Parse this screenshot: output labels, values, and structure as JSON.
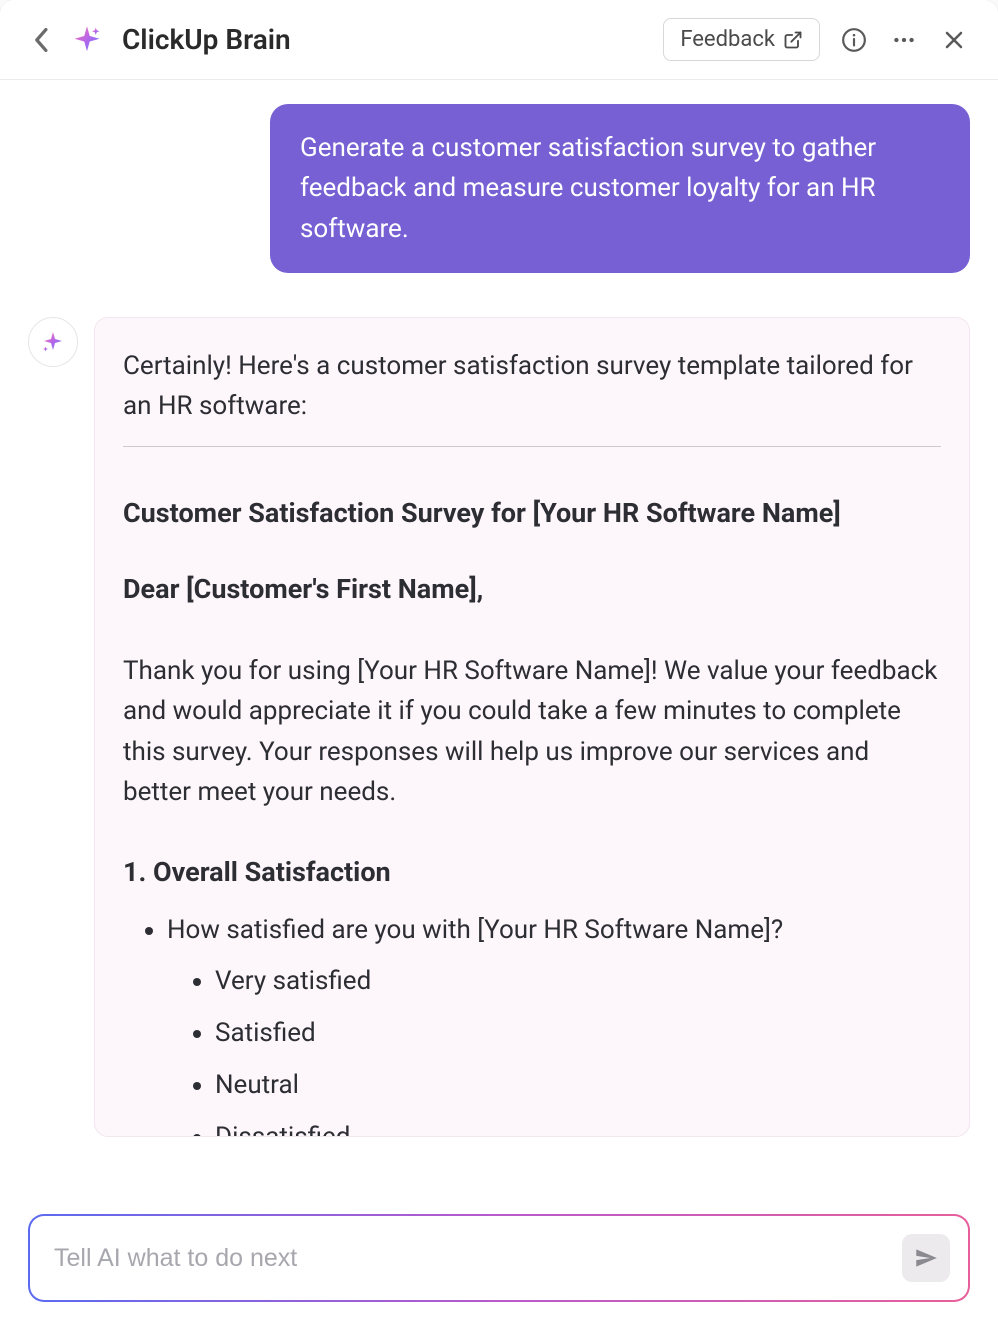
{
  "header": {
    "title": "ClickUp Brain",
    "feedback_label": "Feedback"
  },
  "chat": {
    "user_message": "Generate a customer satisfaction survey to gather feedback and measure customer loyalty for an HR software.",
    "ai": {
      "intro": "Certainly! Here's a customer satisfaction survey template tailored for an HR software:",
      "survey_heading": "Customer Satisfaction Survey for [Your HR Software Name]",
      "salutation": "Dear [Customer's First Name],",
      "body": "Thank you for using [Your HR Software Name]! We value your feedback and would appreciate it if you could take a few minutes to complete this survey. Your responses will help us improve our services and better meet your needs.",
      "section1_title": "1. Overall Satisfaction",
      "question1": "How satisfied are you with [Your HR Software Name]?",
      "options": [
        "Very satisfied",
        "Satisfied",
        "Neutral",
        "Dissatisfied"
      ]
    }
  },
  "input": {
    "placeholder": "Tell AI what to do next"
  },
  "icons": {
    "back": "chevron-left-icon",
    "logo": "sparkle-logo-icon",
    "external": "external-link-icon",
    "info": "info-icon",
    "more": "more-horizontal-icon",
    "close": "close-icon",
    "ai_avatar": "sparkle-icon",
    "send": "send-icon"
  }
}
